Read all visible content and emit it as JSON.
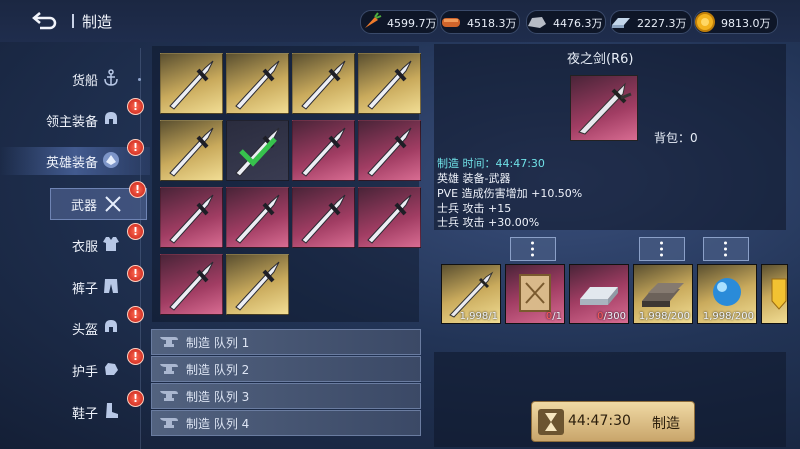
{
  "header": {
    "title": "制造",
    "resources": [
      {
        "icon": "carrot-icon",
        "value": "4599.7万"
      },
      {
        "icon": "bread-icon",
        "value": "4518.3万"
      },
      {
        "icon": "stone-icon",
        "value": "4476.3万"
      },
      {
        "icon": "iron-icon",
        "value": "2227.3万"
      },
      {
        "icon": "gold-coin-icon",
        "value": "9813.0万"
      }
    ]
  },
  "sidebar": {
    "items": [
      {
        "label": "货船",
        "icon": "anchor-icon",
        "badge": ""
      },
      {
        "label": "领主装备",
        "icon": "helmet-icon",
        "badge": "!"
      },
      {
        "label": "英雄装备",
        "icon": "hero-icon",
        "badge": "!"
      },
      {
        "label": "武器",
        "icon": "crossed-swords-icon",
        "badge": "!"
      },
      {
        "label": "衣服",
        "icon": "armor-icon",
        "badge": "!"
      },
      {
        "label": "裤子",
        "icon": "pants-icon",
        "badge": "!"
      },
      {
        "label": "头盔",
        "icon": "helmet-icon",
        "badge": "!"
      },
      {
        "label": "护手",
        "icon": "gauntlet-icon",
        "badge": "!"
      },
      {
        "label": "鞋子",
        "icon": "boot-icon",
        "badge": "!"
      }
    ]
  },
  "queues": [
    {
      "label": "制造 队列 1"
    },
    {
      "label": "制造 队列 2"
    },
    {
      "label": "制造 队列 3"
    },
    {
      "label": "制造 队列 4"
    }
  ],
  "detail": {
    "name": "夜之剑(R6)",
    "bag": "背包：0",
    "craft_time": "制造 时间：44:47:30",
    "stats": [
      "英雄 装备-武器",
      "PVE 造成伤害增加 +10.50%",
      "士兵 攻击 +15",
      "士兵 攻击 +30.00%"
    ]
  },
  "materials": [
    {
      "name": "sword-material",
      "have": "1,998",
      "need": "/1",
      "enough": true
    },
    {
      "name": "scroll-material",
      "have": "0",
      "need": "/1",
      "enough": false
    },
    {
      "name": "silver-ingot-material",
      "have": "0",
      "need": "/300",
      "enough": false
    },
    {
      "name": "iron-ingot-material",
      "have": "1,998",
      "need": "/200",
      "enough": true
    },
    {
      "name": "blue-orb-material",
      "have": "1,998",
      "need": "/200",
      "enough": true
    },
    {
      "name": "golden-shield-material",
      "have": "",
      "need": "",
      "enough": true
    }
  ],
  "craft_button": {
    "time": "44:47:30",
    "label": "制造"
  }
}
